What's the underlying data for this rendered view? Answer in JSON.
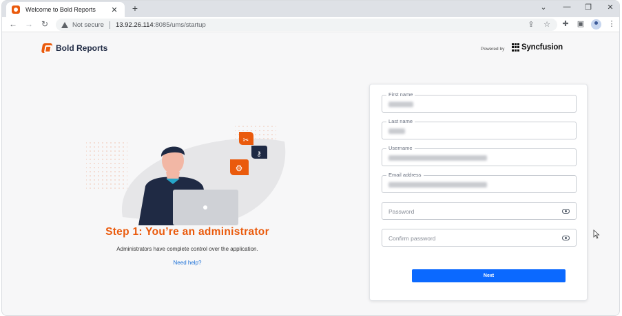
{
  "browser": {
    "tab_title": "Welcome to Bold Reports",
    "tab_close": "✕",
    "new_tab": "+",
    "window_controls": [
      "⌄",
      "—",
      "❐",
      "✕"
    ],
    "nav": [
      "←",
      "→",
      "↻"
    ],
    "security_label": "Not secure",
    "url_host": "13.92.26.114",
    "url_path": ":8085/ums/startup",
    "icons": [
      "share-icon",
      "star-icon",
      "extensions-icon",
      "sidepanel-icon",
      "profile-icon",
      "menu-icon"
    ]
  },
  "header": {
    "brand_name": "Bold Reports",
    "powered_by": "Powered by",
    "partner_name": "Syncfusion"
  },
  "intro": {
    "title": "Step 1: You’re an administrator",
    "description": "Administrators have complete control over the application.",
    "help_link": "Need help?"
  },
  "form": {
    "first_name": {
      "label": "First name",
      "value": "••••••"
    },
    "last_name": {
      "label": "Last name",
      "value": "••••"
    },
    "username": {
      "label": "Username",
      "value": "•••••••••••••••••••••••••••"
    },
    "email": {
      "label": "Email address",
      "value": "•••••••••••••••••••••••••••"
    },
    "password": {
      "placeholder": "Password"
    },
    "confirm_password": {
      "placeholder": "Confirm password"
    },
    "next_label": "Next"
  },
  "colors": {
    "brand_orange": "#ea5a0c",
    "primary_blue": "#0b69ff",
    "navy": "#1f2a44"
  }
}
